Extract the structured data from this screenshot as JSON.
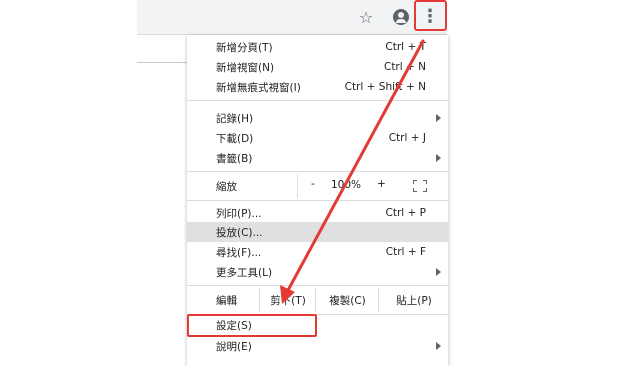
{
  "toolbar": {
    "star_icon": "star-icon",
    "account_icon": "account-circle-icon",
    "menu_icon": "more-vert-icon",
    "menu_glyph": "⋮"
  },
  "menu": {
    "items": [
      {
        "label": "新增分頁(T)",
        "shortcut": "Ctrl + T"
      },
      {
        "label": "新增視窗(N)",
        "shortcut": "Ctrl + N"
      },
      {
        "label": "新增無痕式視窗(I)",
        "shortcut": "Ctrl + Shift + N"
      },
      {
        "label": "記錄(H)",
        "shortcut": ""
      },
      {
        "label": "下載(D)",
        "shortcut": "Ctrl + J"
      },
      {
        "label": "書籤(B)",
        "shortcut": ""
      },
      {
        "label": "列印(P)...",
        "shortcut": "Ctrl + P"
      },
      {
        "label": "投放(C)...",
        "shortcut": ""
      },
      {
        "label": "尋找(F)...",
        "shortcut": "Ctrl + F"
      },
      {
        "label": "更多工具(L)",
        "shortcut": ""
      },
      {
        "label": "設定(S)",
        "shortcut": ""
      },
      {
        "label": "說明(E)",
        "shortcut": ""
      }
    ],
    "zoom": {
      "label": "縮放",
      "minus": "-",
      "value": "100%",
      "plus": "+"
    },
    "edit": {
      "label": "編輯",
      "cut": "剪下(T)",
      "copy": "複製(C)",
      "paste": "貼上(P)"
    }
  },
  "annotation": {
    "color": "#e53935"
  }
}
